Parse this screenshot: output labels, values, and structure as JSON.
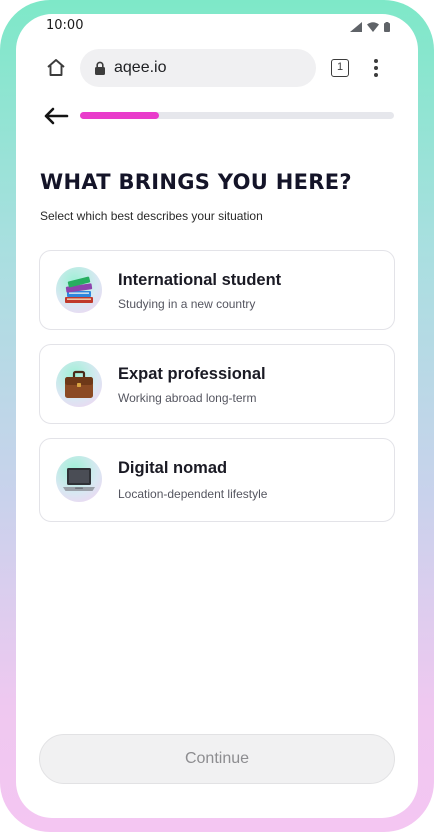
{
  "status_bar": {
    "time": "10:00"
  },
  "browser": {
    "url": "aqee.io",
    "tab_count": "1"
  },
  "progress": {
    "fraction": 0.25
  },
  "header": {
    "title": "WHAT BRINGS YOU HERE?",
    "subtitle": "Select which best describes your situation"
  },
  "options": [
    {
      "title": "International student",
      "subtitle": "Studying in a new country",
      "icon": "books-icon"
    },
    {
      "title": "Expat professional",
      "subtitle": "Working abroad long-term",
      "icon": "briefcase-icon"
    },
    {
      "title": "Digital nomad",
      "subtitle": "Location-dependent lifestyle",
      "icon": "laptop-icon"
    }
  ],
  "footer": {
    "continue_label": "Continue"
  },
  "colors": {
    "accent": "#e93bcb",
    "frame_top": "#7ee8c8",
    "frame_bottom": "#f4c6f2"
  }
}
